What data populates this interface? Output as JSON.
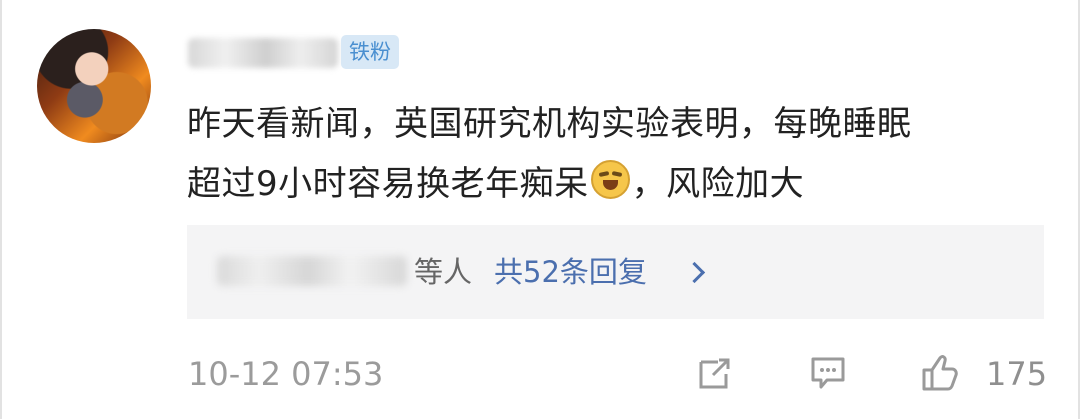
{
  "post": {
    "badge": "铁粉",
    "comment_line1": "昨天看新闻，英国研究机构实验表明，每晚睡眠",
    "comment_line2_before_emoji": "超过9小时容易换老年痴呆",
    "comment_line2_after_emoji": "，风险加大",
    "reply_suffix": "等人",
    "reply_count": "共52条回复",
    "timestamp": "10-12 07:53",
    "like_count": "175"
  },
  "icons": {
    "avatar": "user-avatar",
    "emoji": "laughing-crying-emoji",
    "chevron": "chevron-right-icon",
    "share": "share-icon",
    "comment": "comment-icon",
    "like": "thumbs-up-icon"
  },
  "colors": {
    "badge_bg": "#d8e8f6",
    "badge_text": "#4a8fd0",
    "reply_link": "#4b6fae",
    "secondary_text": "#9b9b9b"
  }
}
